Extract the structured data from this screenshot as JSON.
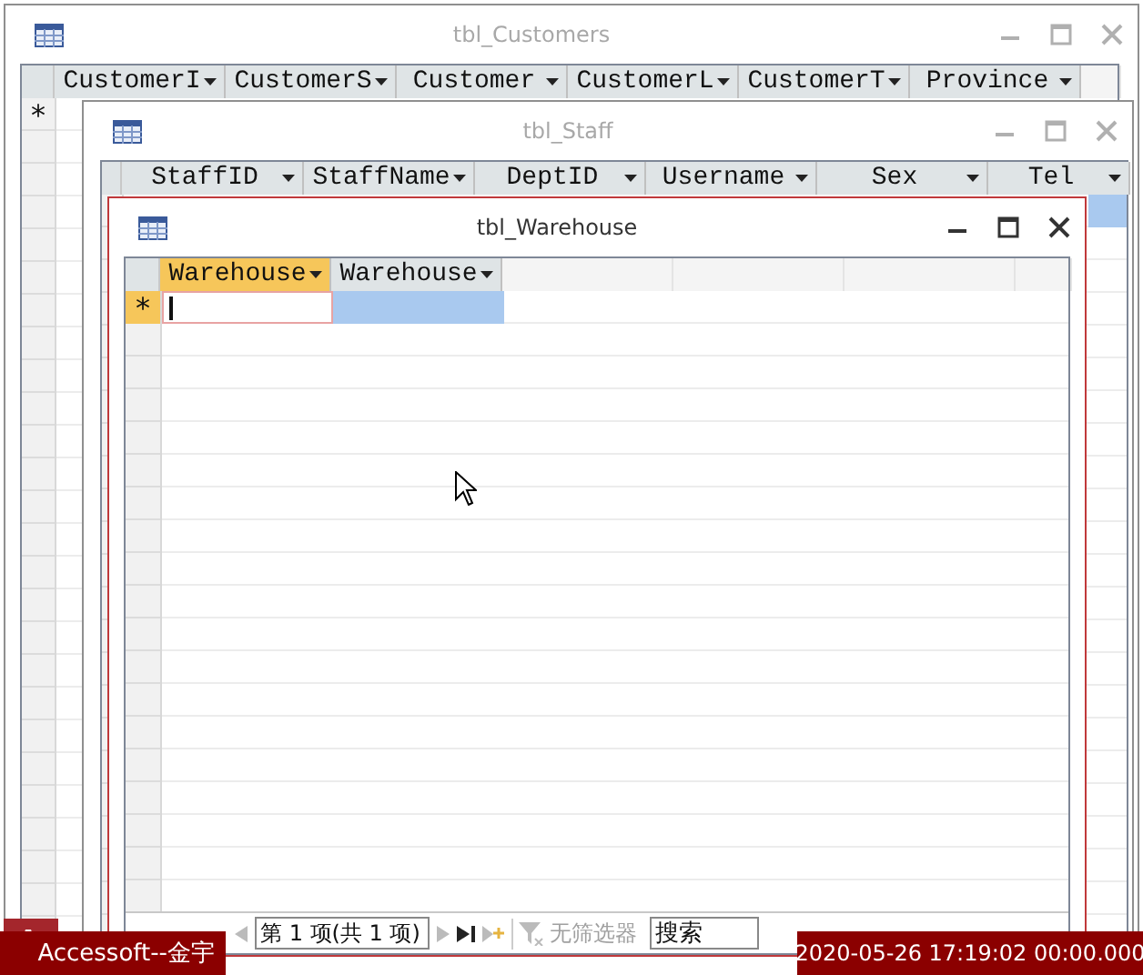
{
  "windows": [
    {
      "title": "tbl_Customers",
      "active": false,
      "columns": [
        {
          "label": "CustomerI",
          "selected": false
        },
        {
          "label": "CustomerS",
          "selected": false
        },
        {
          "label": "Customer",
          "selected": false
        },
        {
          "label": "CustomerL",
          "selected": false
        },
        {
          "label": "CustomerT",
          "selected": false
        },
        {
          "label": "Province",
          "selected": false
        }
      ],
      "rows": [
        {
          "marker": "*",
          "selected": false
        }
      ]
    },
    {
      "title": "tbl_Staff",
      "active": false,
      "columns": [
        {
          "label": "StaffID",
          "selected": false
        },
        {
          "label": "StaffName",
          "selected": false
        },
        {
          "label": "DeptID",
          "selected": false
        },
        {
          "label": "Username",
          "selected": false
        },
        {
          "label": "Sex",
          "selected": false
        },
        {
          "label": "Tel",
          "selected": false
        }
      ],
      "rows": [
        {
          "marker": "",
          "selected": true
        }
      ]
    },
    {
      "title": "tbl_Warehouse",
      "active": true,
      "columns": [
        {
          "label": "Warehouse",
          "selected": true
        },
        {
          "label": "Warehouse",
          "selected": false
        }
      ],
      "rows": [
        {
          "marker": "*",
          "selected": true
        }
      ],
      "navigation": {
        "record": "第 1 项(共 1 项)",
        "filter": "无筛选器",
        "filter_disabled": true,
        "search_placeholder": "搜索"
      }
    }
  ],
  "overlay": {
    "app_label": "Accessoft--金宇",
    "timestamp": "2020-05-26 17:19:02 00:00.000"
  }
}
